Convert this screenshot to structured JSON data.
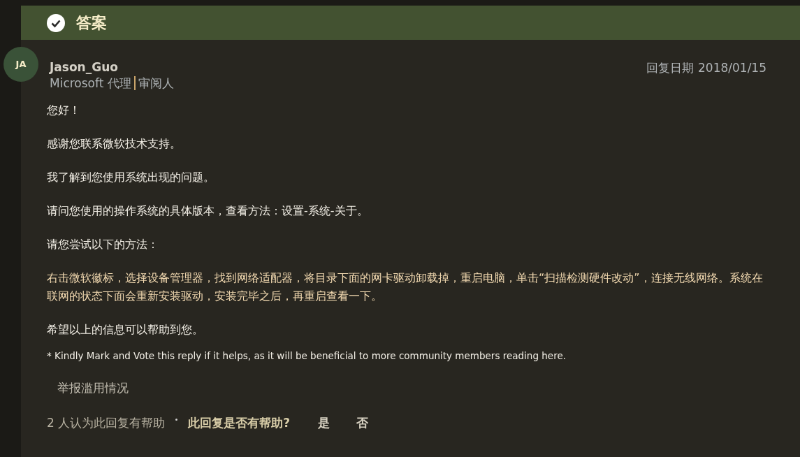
{
  "header": {
    "title": "答案"
  },
  "reply": {
    "avatar": "JA",
    "author": "Jason_Guo",
    "role": "Microsoft 代理",
    "badge": "审阅人",
    "date_label": "回复日期",
    "date": "2018/01/15"
  },
  "paragraphs": [
    {
      "kind": "normal",
      "text": "您好！"
    },
    {
      "kind": "normal",
      "text": "感谢您联系微软技术支持。"
    },
    {
      "kind": "normal",
      "text": "我了解到您使用系统出现的问题。"
    },
    {
      "kind": "normal",
      "text": "请问您使用的操作系统的具体版本，查看方法：设置-系统-关于。"
    },
    {
      "kind": "normal",
      "text": "请您尝试以下的方法："
    },
    {
      "kind": "highlight",
      "text": "右击微软徽标，选择设备管理器，找到网络适配器，将目录下面的网卡驱动卸载掉，重启电脑，单击“扫描检测硬件改动”，连接无线网络。系统在联网的状态下面会重新安装驱动，安装完毕之后，再重启查看一下。"
    },
    {
      "kind": "normal",
      "text": "希望以上的信息可以帮助到您。"
    },
    {
      "kind": "note",
      "text": "* Kindly Mark and Vote this reply if it helps, as it will be beneficial to more community members reading here."
    }
  ],
  "report_link": "举报滥用情况",
  "footer": {
    "helpful_count": "2 人认为此回复有帮助",
    "question": "此回复是否有帮助?",
    "buttons": [
      "是",
      "否"
    ]
  }
}
